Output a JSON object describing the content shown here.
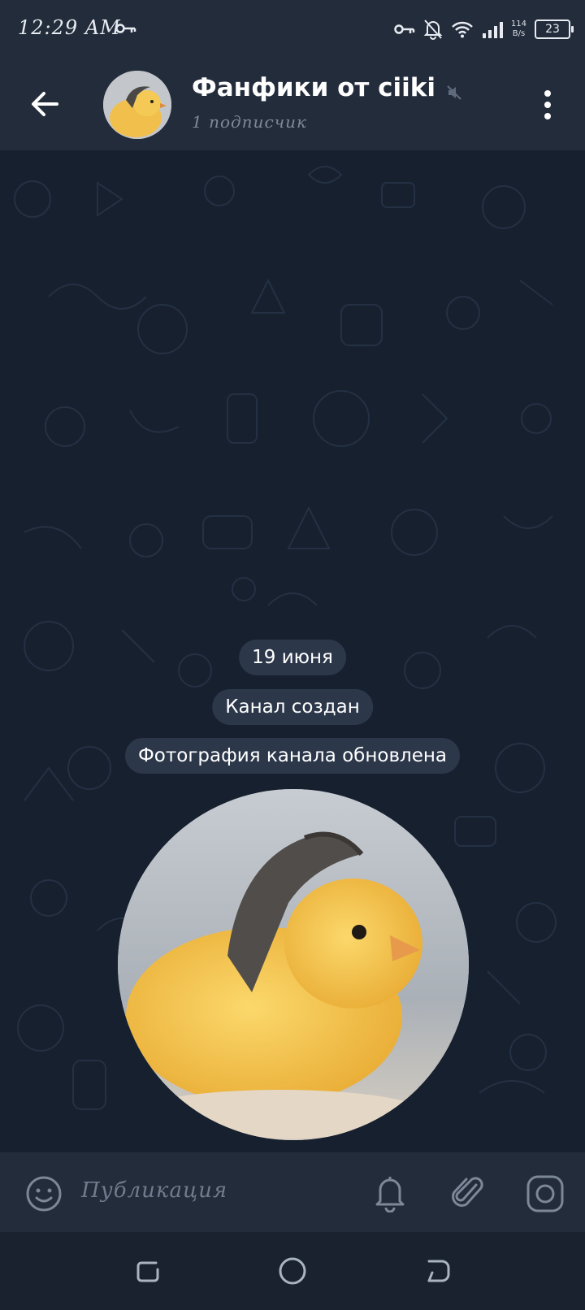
{
  "status_bar": {
    "time": "12:29 AM",
    "speed_value": "114",
    "speed_unit": "B/s",
    "battery": "23"
  },
  "header": {
    "title": "Фанфики от ciiki",
    "subtitle": "1 подписчик"
  },
  "chat": {
    "date_label": "19 июня",
    "service_messages": [
      "Канал создан",
      "Фотография канала обновлена"
    ]
  },
  "composer": {
    "placeholder": "Публикация"
  },
  "colors": {
    "header_bg": "#232c3b",
    "chat_bg": "#17202e",
    "pill_bg": "#2c384a",
    "muted_text": "#7f8a9a"
  },
  "icons": {
    "back": "arrow-left-icon",
    "mute": "speaker-muted-icon",
    "menu": "more-vertical-icon",
    "emoji": "smile-icon",
    "bell": "bell-icon",
    "attach": "paperclip-icon",
    "camera": "camera-icon"
  }
}
